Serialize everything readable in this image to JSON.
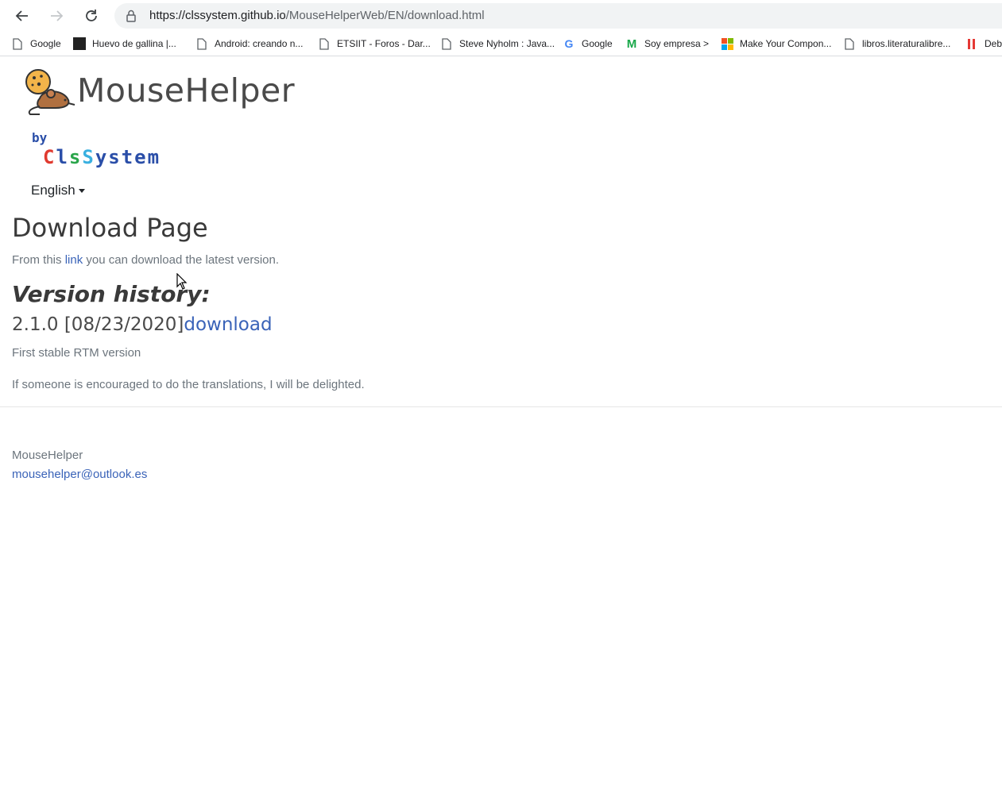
{
  "browser": {
    "url_host": "https://clssystem.github.io",
    "url_path": "/MouseHelperWeb/EN/download.html",
    "bookmarks": [
      {
        "label": "Google",
        "icon": "page-icon"
      },
      {
        "label": "Huevo de gallina |...",
        "icon": "site-icon"
      },
      {
        "label": "Android: creando n...",
        "icon": "page-icon"
      },
      {
        "label": "ETSIIT - Foros - Dar...",
        "icon": "page-icon"
      },
      {
        "label": "Steve Nyholm : Java...",
        "icon": "page-icon"
      },
      {
        "label": "Google",
        "icon": "google-icon"
      },
      {
        "label": "Soy empresa >",
        "icon": "movistar-icon"
      },
      {
        "label": "Make Your Compon...",
        "icon": "microsoft-icon"
      },
      {
        "label": "libros.literaturalibre...",
        "icon": "page-icon"
      },
      {
        "label": "Deb",
        "icon": "red-bars-icon"
      }
    ]
  },
  "header": {
    "brand": "MouseHelper",
    "by": "by",
    "company": [
      "C",
      "l",
      "s",
      "S",
      "y",
      "s",
      "t",
      "e",
      "m"
    ],
    "company_colors": [
      "#e03a2f",
      "#2a4ea8",
      "#2aa54a",
      "#3ab0e0",
      "#2a4ea8",
      "#2a4ea8",
      "#2a4ea8",
      "#2a4ea8",
      "#2a4ea8"
    ],
    "language": "English"
  },
  "main": {
    "title": "Download Page",
    "lead_before": "From this ",
    "lead_link": "link",
    "lead_after": " you can download the latest version.",
    "history_title": "Version history:",
    "version": "2.1.0 [08/23/2020]",
    "version_link": "download",
    "version_note": "First stable RTM version",
    "translations_note": "If someone is encouraged to do the translations, I will be delighted."
  },
  "footer": {
    "name": "MouseHelper",
    "email": "mousehelper@outlook.es"
  }
}
